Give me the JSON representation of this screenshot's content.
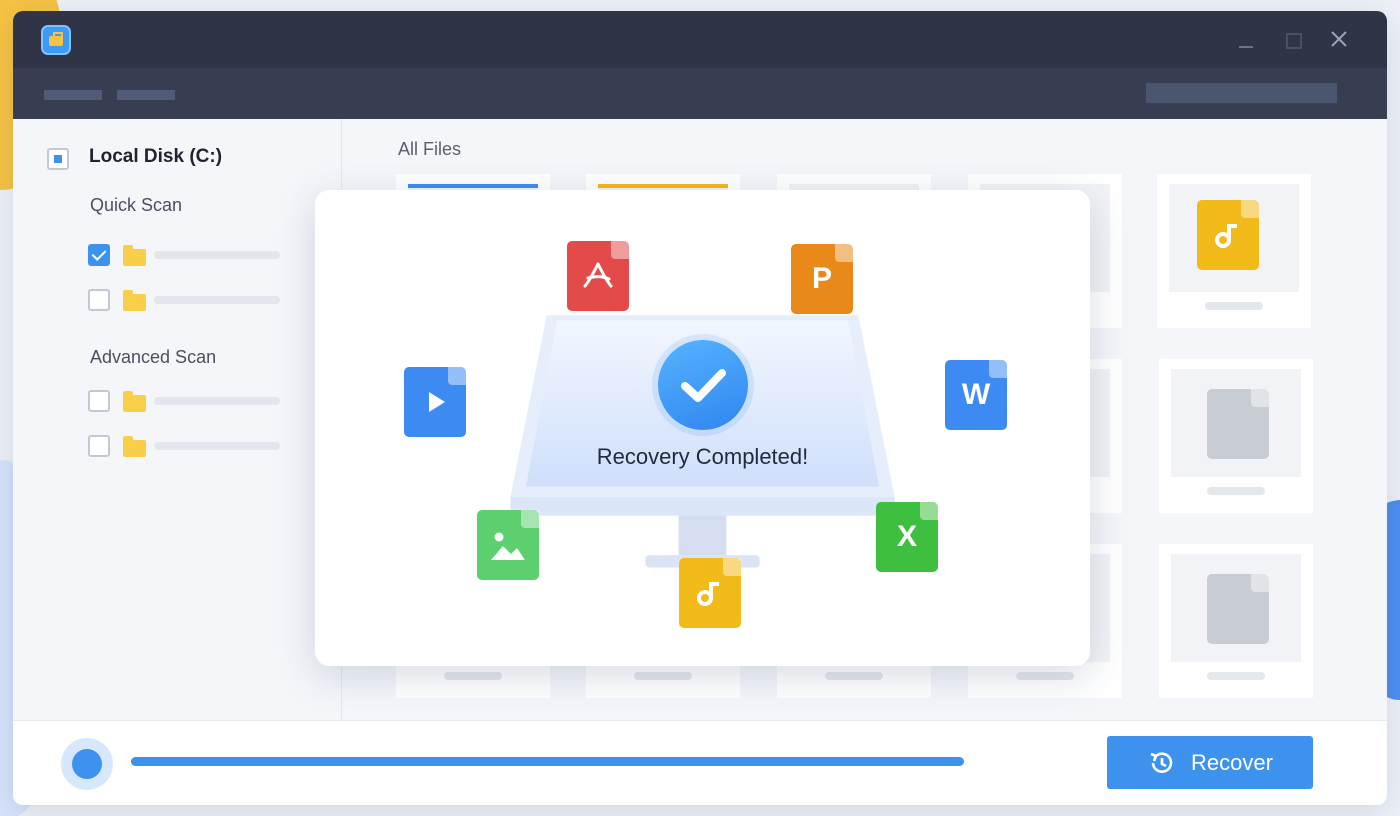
{
  "window": {
    "title_icon": "toolbox-icon"
  },
  "sidebar": {
    "disk_label": "Local Disk (C:)",
    "quick_scan_label": "Quick Scan",
    "advanced_scan_label": "Advanced Scan",
    "quick_items": [
      {
        "checked": true
      },
      {
        "checked": false
      }
    ],
    "advanced_items": [
      {
        "checked": false
      },
      {
        "checked": false
      }
    ]
  },
  "main": {
    "header": "All Files"
  },
  "dialog": {
    "status": "Recovery Completed!",
    "file_types": [
      "pdf-file-icon",
      "powerpoint-file-icon",
      "video-file-icon",
      "word-file-icon",
      "image-file-icon",
      "excel-file-icon",
      "audio-file-icon"
    ],
    "ppt_letter": "P",
    "word_letter": "W",
    "excel_letter": "X"
  },
  "footer": {
    "progress": 1.0,
    "recover_label": "Recover"
  },
  "colors": {
    "accent": "#3d92ee",
    "titlebar": "#2f3547",
    "pdf": "#e34b4b",
    "ppt": "#e8891a",
    "word": "#3d8bf2",
    "excel": "#3fbf3f",
    "image": "#5ccf6f",
    "audio": "#f2bb1a",
    "video": "#3d8bf2"
  }
}
